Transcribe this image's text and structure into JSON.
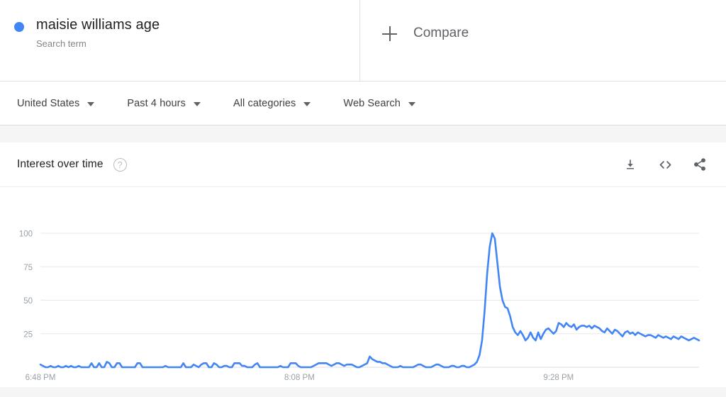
{
  "search_term": {
    "title": "maisie williams age",
    "subtitle": "Search term",
    "dot_color": "#4285f4"
  },
  "compare": {
    "label": "Compare",
    "icon": "plus-icon"
  },
  "filters": [
    {
      "label": "United States",
      "name": "region"
    },
    {
      "label": "Past 4 hours",
      "name": "time-range"
    },
    {
      "label": "All categories",
      "name": "category"
    },
    {
      "label": "Web Search",
      "name": "search-type"
    }
  ],
  "card": {
    "title": "Interest over time",
    "help_icon": "help-circle-icon",
    "help_glyph": "?",
    "actions": [
      {
        "name": "download-icon",
        "label": "Download"
      },
      {
        "name": "embed-code-icon",
        "label": "Embed"
      },
      {
        "name": "share-icon",
        "label": "Share"
      }
    ]
  },
  "chart_data": {
    "type": "line",
    "title": "Interest over time",
    "xlabel": "",
    "ylabel": "",
    "ylim": [
      0,
      100
    ],
    "yticks": [
      25,
      50,
      75,
      100
    ],
    "ytick_labels": [
      "25",
      "50",
      "75",
      "100"
    ],
    "xticks": [
      "6:48 PM",
      "8:08 PM",
      "9:28 PM"
    ],
    "xtick_positions": [
      0,
      0.3933,
      0.7867
    ],
    "grid": true,
    "legend": "none",
    "line_color": "#4285f4",
    "series": [
      {
        "name": "maisie williams age",
        "values": [
          2,
          1,
          0,
          0,
          1,
          0,
          0,
          1,
          0,
          0,
          1,
          0,
          1,
          0,
          0,
          1,
          0,
          0,
          0,
          0,
          3,
          0,
          0,
          3,
          0,
          0,
          4,
          3,
          0,
          0,
          3,
          3,
          0,
          0,
          0,
          0,
          0,
          0,
          3,
          3,
          0,
          0,
          0,
          0,
          0,
          0,
          0,
          0,
          0,
          1,
          0,
          0,
          0,
          0,
          0,
          0,
          3,
          0,
          0,
          0,
          2,
          1,
          0,
          2,
          3,
          3,
          0,
          0,
          3,
          2,
          0,
          0,
          1,
          1,
          0,
          0,
          3,
          3,
          3,
          1,
          1,
          0,
          0,
          0,
          2,
          3,
          0,
          0,
          0,
          0,
          0,
          0,
          0,
          0,
          1,
          0,
          0,
          0,
          3,
          3,
          3,
          1,
          0,
          0,
          0,
          0,
          0,
          1,
          2,
          3,
          3,
          3,
          3,
          2,
          1,
          2,
          3,
          3,
          2,
          1,
          2,
          2,
          2,
          1,
          0,
          0,
          1,
          2,
          3,
          8,
          6,
          5,
          4,
          4,
          3,
          3,
          2,
          1,
          0,
          0,
          0,
          1,
          0,
          0,
          0,
          0,
          0,
          1,
          2,
          2,
          1,
          0,
          0,
          0,
          1,
          2,
          2,
          1,
          0,
          0,
          0,
          1,
          1,
          0,
          0,
          1,
          1,
          0,
          0,
          1,
          2,
          4,
          9,
          20,
          42,
          70,
          90,
          100,
          96,
          78,
          60,
          50,
          45,
          44,
          38,
          30,
          26,
          24,
          27,
          24,
          20,
          22,
          26,
          22,
          20,
          26,
          21,
          25,
          28,
          29,
          27,
          25,
          27,
          33,
          32,
          30,
          33,
          31,
          30,
          32,
          28,
          30,
          31,
          31,
          30,
          31,
          29,
          31,
          30,
          29,
          27,
          26,
          29,
          27,
          25,
          28,
          27,
          25,
          23,
          26,
          27,
          25,
          26,
          24,
          26,
          25,
          24,
          23,
          24,
          24,
          23,
          22,
          24,
          23,
          22,
          23,
          22,
          21,
          23,
          22,
          21,
          23,
          22,
          21,
          20,
          21,
          22,
          21,
          20
        ]
      }
    ]
  }
}
